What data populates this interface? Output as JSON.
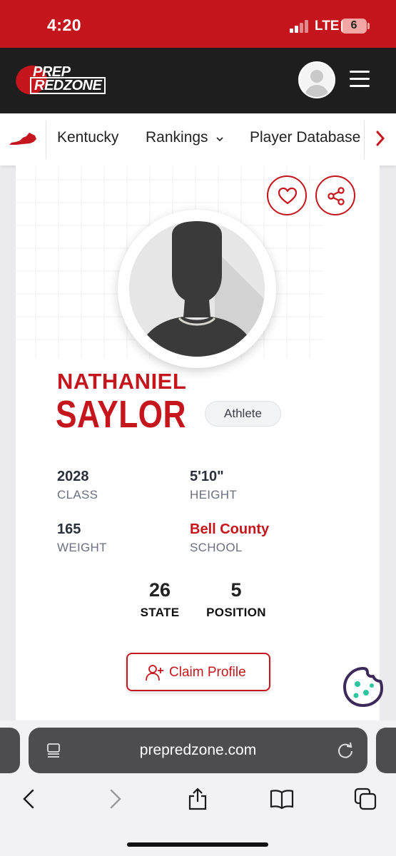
{
  "status_bar": {
    "time": "4:20",
    "network": "LTE",
    "battery_level": "6",
    "battery_fraction": 0.06
  },
  "header": {
    "logo_line1": "PREP",
    "logo_line2": "REDZONE"
  },
  "nav": {
    "items": [
      "Kentucky",
      "Rankings",
      "Player Database"
    ]
  },
  "player": {
    "first_name": "NATHANIEL",
    "last_name": "SAYLOR",
    "position_badge": "Athlete",
    "stats": {
      "class_value": "2028",
      "class_label": "CLASS",
      "height_value": "5'10\"",
      "height_label": "HEIGHT",
      "weight_value": "165",
      "weight_label": "WEIGHT",
      "school_value": "Bell County",
      "school_label": "SCHOOL"
    },
    "ranks": {
      "state_value": "26",
      "state_label": "STATE",
      "position_value": "5",
      "position_label": "POSITION"
    },
    "claim_label": "Claim Profile"
  },
  "browser": {
    "url": "prepredzone.com"
  },
  "colors": {
    "brand_red": "#c4161c",
    "header_dark": "#1e1e1e",
    "cookie_purple": "#3b2a5a",
    "cookie_teal": "#2bc6a0"
  },
  "icons": [
    "heart-icon",
    "share-icon",
    "user-plus-icon",
    "cookie-icon",
    "reader-icon",
    "reload-icon",
    "back-icon",
    "forward-icon",
    "share-sheet-icon",
    "bookmarks-icon",
    "tabs-icon",
    "kentucky-map-icon",
    "hamburger-icon",
    "chevron-down-icon",
    "chevron-right-icon"
  ]
}
